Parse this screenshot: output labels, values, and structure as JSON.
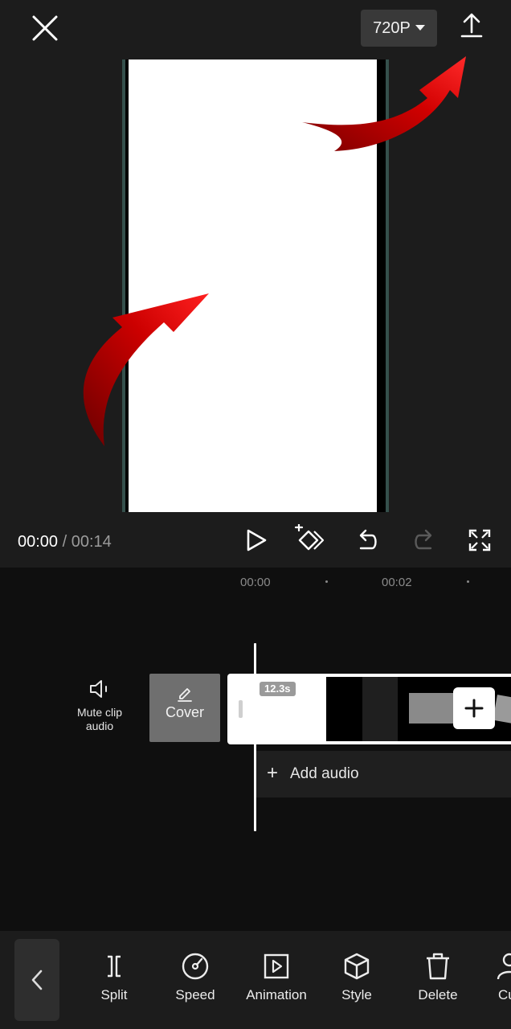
{
  "header": {
    "resolution_label": "720P",
    "icons": [
      "close-icon",
      "chevron-down-icon",
      "export-upload-icon"
    ]
  },
  "annotations": {
    "arrow_color": "#c40000",
    "arrows": [
      "red-arrow-pointing-to-export",
      "red-arrow-pointing-to-preview"
    ]
  },
  "playback": {
    "current_time": "00:00",
    "separator": " / ",
    "total_time": "00:14",
    "icons": [
      "play-icon",
      "keyframe-icon",
      "undo-icon",
      "redo-icon",
      "fullscreen-icon"
    ]
  },
  "timeline": {
    "ruler": [
      "00:00",
      "00:02"
    ],
    "mute_label_line1": "Mute clip",
    "mute_label_line2": "audio",
    "cover_label": "Cover",
    "clip_duration": "12.3s",
    "add_audio_label": "Add audio",
    "add_audio_plus": "+"
  },
  "toolbar": {
    "items": [
      {
        "label": "Split",
        "icon": "split-icon"
      },
      {
        "label": "Speed",
        "icon": "speed-icon"
      },
      {
        "label": "Animation",
        "icon": "animation-icon"
      },
      {
        "label": "Style",
        "icon": "style-cube-icon"
      },
      {
        "label": "Delete",
        "icon": "delete-icon"
      },
      {
        "label": "Cu",
        "icon": "cutout-icon"
      }
    ]
  },
  "colors": {
    "background": "#1c1c1c",
    "timeline_bg": "#0f0f0f",
    "preview_bg": "#ffffff",
    "accent_red": "#c40000"
  }
}
